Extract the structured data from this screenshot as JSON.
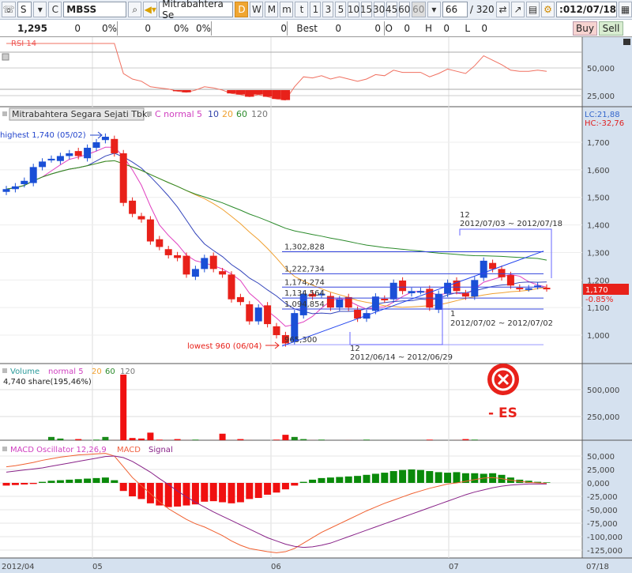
{
  "toolbar": {
    "market": "S",
    "type": "C",
    "code": "MBSS",
    "name": "Mitrabahtera Se",
    "periods": [
      "D",
      "W",
      "M",
      "m",
      "t"
    ],
    "active_period": "D",
    "minutes": [
      "1",
      "3",
      "5",
      "10",
      "15",
      "30",
      "45",
      "60"
    ],
    "minute_select": "60",
    "count": "66",
    "total": "/ 320",
    "date": ":012/07/18"
  },
  "info": {
    "price": "1,295",
    "v1": "0",
    "p1": "0%",
    "v2": "0",
    "p2": "0%",
    "p3": "0%",
    "v3": "0",
    "best": "Best",
    "b1": "0",
    "b2": "0",
    "o": "O",
    "ov": "0",
    "h": "H",
    "hv": "0",
    "l": "L",
    "lv": "0",
    "buy": "Buy",
    "sell": "Sell"
  },
  "rsi": {
    "title": "RSI 14",
    "ticks": [
      "50,000",
      "25,000"
    ]
  },
  "price": {
    "title": "Mitrabahtera Segara Sejati Tbk.",
    "ma_label": "C normal",
    "ma": [
      "5",
      "10",
      "20",
      "60",
      "120"
    ],
    "lc": "LC:21,88",
    "hc": "HC:-32,76",
    "ticks": [
      "1,700",
      "1,600",
      "1,500",
      "1,400",
      "1,300",
      "1,200",
      "1,100",
      "1,000"
    ],
    "highest": "highest 1,740 (05/02)",
    "lowest": "lowest 960 (06/04)",
    "last": "1,170",
    "change": "-0.85%",
    "levels": [
      "1,302,828",
      "1,222,734",
      "1,174,274",
      "1,134,564",
      "1,094,854",
      "965,300"
    ],
    "boxes": [
      {
        "n": "12",
        "range": "2012/06/14 ~ 2012/06/29"
      },
      {
        "n": "1",
        "range": "2012/07/02 ~ 2012/07/02"
      },
      {
        "n": "12",
        "range": "2012/07/03 ~ 2012/07/18"
      }
    ]
  },
  "volume": {
    "title": "Volume",
    "ma_label": "normal 5",
    "ma": [
      "20",
      "60",
      "120"
    ],
    "info": "4,740 share(195,46%)",
    "ticks": [
      "500,000",
      "250,000"
    ]
  },
  "macd": {
    "title": "MACD Oscillator 12,26,9",
    "macd": "MACD",
    "signal": "Signal",
    "ticks": [
      "50,000",
      "25,000",
      "0,000",
      "-25,000",
      "-50,000",
      "-75,000",
      "-100,000",
      "-125,000"
    ]
  },
  "xaxis": {
    "labels": [
      "2012/04",
      "05",
      "06",
      "07"
    ],
    "last": "07/18"
  },
  "overlay": {
    "text": "- ES"
  },
  "colors": {
    "up": "#1a4fd6",
    "down": "#e8211a",
    "axis_bg": "#d5e1ef"
  },
  "chart_data": {
    "type": "candlestick",
    "closes": [
      1530,
      1540,
      1560,
      1610,
      1630,
      1640,
      1650,
      1660,
      1650,
      1680,
      1700,
      1720,
      1660,
      1480,
      1440,
      1420,
      1340,
      1320,
      1290,
      1280,
      1220,
      1240,
      1280,
      1240,
      1220,
      1130,
      1120,
      1050,
      1100,
      1040,
      1000,
      970,
      1080,
      1150,
      1140,
      1150,
      1100,
      1130,
      1100,
      1060,
      1080,
      1140,
      1130,
      1190,
      1160,
      1160,
      1160,
      1100,
      1150,
      1190,
      1160,
      1140,
      1200,
      1270,
      1240,
      1210,
      1180,
      1170,
      1170,
      1180,
      1170
    ],
    "volume": [
      20,
      25,
      20,
      30,
      20,
      60,
      45,
      25,
      40,
      30,
      35,
      60,
      30,
      640,
      50,
      45,
      100,
      35,
      30,
      40,
      30,
      35,
      25,
      30,
      90,
      30,
      40,
      30,
      20,
      25,
      35,
      80,
      60,
      40,
      30,
      35,
      25,
      20,
      30,
      25,
      35,
      30,
      25,
      30,
      20,
      25,
      30,
      35,
      20,
      25,
      30,
      40,
      35,
      30,
      25,
      20,
      20,
      25,
      20,
      15,
      12
    ],
    "macd_hist": [
      -5000,
      -4000,
      -3000,
      -2000,
      2000,
      4000,
      5000,
      6000,
      7000,
      8000,
      9000,
      10000,
      5000,
      -15000,
      -25000,
      -30000,
      -38000,
      -42000,
      -45000,
      -44000,
      -42000,
      -40000,
      -35000,
      -34000,
      -36000,
      -38000,
      -36000,
      -30000,
      -28000,
      -22000,
      -18000,
      -12000,
      -5000,
      2000,
      6000,
      9000,
      10000,
      11000,
      12000,
      13000,
      15000,
      17000,
      19000,
      22000,
      24000,
      25000,
      24000,
      22000,
      20000,
      19000,
      20000,
      18000,
      18000,
      17000,
      18000,
      15000,
      10000,
      6000,
      4000,
      2000,
      1000
    ],
    "macd_line": [
      30000,
      32000,
      35000,
      38000,
      42000,
      45000,
      48000,
      50000,
      52000,
      53000,
      54000,
      55000,
      50000,
      30000,
      10000,
      -5000,
      -20000,
      -35000,
      -48000,
      -58000,
      -68000,
      -76000,
      -82000,
      -90000,
      -98000,
      -108000,
      -116000,
      -122000,
      -125000,
      -128000,
      -130000,
      -128000,
      -122000,
      -112000,
      -102000,
      -92000,
      -84000,
      -76000,
      -68000,
      -60000,
      -52000,
      -45000,
      -38000,
      -32000,
      -26000,
      -20000,
      -15000,
      -10000,
      -6000,
      -2000,
      0,
      3000,
      6000,
      9000,
      10000,
      8000,
      5000,
      3000,
      1000,
      0,
      -1000
    ],
    "signal_line": [
      20000,
      22000,
      24000,
      26000,
      28000,
      31000,
      34000,
      37000,
      40000,
      43000,
      46000,
      49000,
      50000,
      47000,
      40000,
      30000,
      20000,
      8000,
      -3000,
      -15000,
      -26000,
      -36000,
      -45000,
      -54000,
      -62000,
      -70000,
      -78000,
      -86000,
      -94000,
      -102000,
      -108000,
      -114000,
      -118000,
      -120000,
      -119000,
      -116000,
      -112000,
      -106000,
      -100000,
      -94000,
      -88000,
      -82000,
      -76000,
      -70000,
      -64000,
      -58000,
      -52000,
      -46000,
      -40000,
      -34000,
      -28000,
      -22000,
      -17000,
      -13000,
      -9000,
      -6000,
      -4000,
      -3000,
      -2000,
      -2000,
      -2000
    ],
    "rsi": [
      77000,
      76000,
      77000,
      79000,
      79000,
      79000,
      80000,
      80000,
      79000,
      80000,
      81000,
      82000,
      80000,
      45000,
      40000,
      38000,
      33000,
      32000,
      31000,
      29000,
      28000,
      30000,
      33000,
      32000,
      30000,
      27000,
      26000,
      24000,
      26000,
      24000,
      22000,
      21000,
      33000,
      42000,
      41000,
      43000,
      40000,
      42000,
      40000,
      38000,
      40000,
      44000,
      43000,
      48000,
      46000,
      46000,
      46000,
      42000,
      45000,
      49000,
      47000,
      45000,
      52000,
      61000,
      57000,
      53000,
      48000,
      47000,
      47000,
      48000,
      47000
    ]
  }
}
